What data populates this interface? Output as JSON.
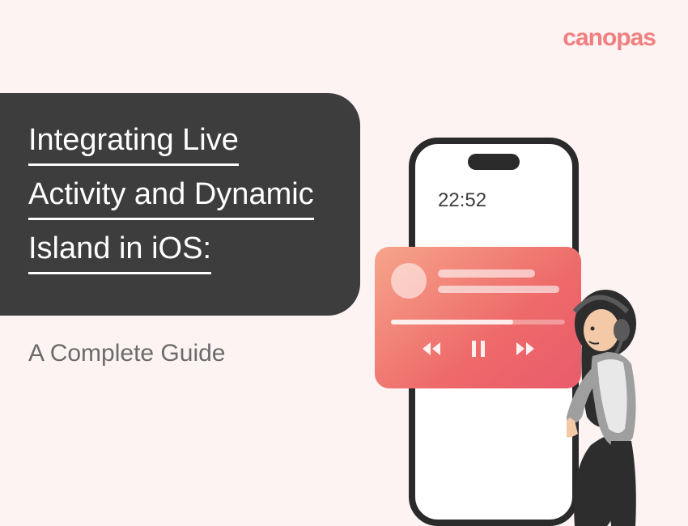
{
  "brand": {
    "name": "canopas"
  },
  "title": {
    "line1": "Integrating Live",
    "line2": "Activity and Dynamic",
    "line3": "Island in iOS:"
  },
  "subtitle": "A Complete Guide",
  "phone": {
    "time": "22:52"
  },
  "widget": {
    "progress_percent": 70
  },
  "colors": {
    "brand": "#f07f7f",
    "title_bg": "#3d3d3d",
    "page_bg": "#fdf3f3",
    "widget_start": "#f6a58b",
    "widget_end": "#e95b6b"
  }
}
